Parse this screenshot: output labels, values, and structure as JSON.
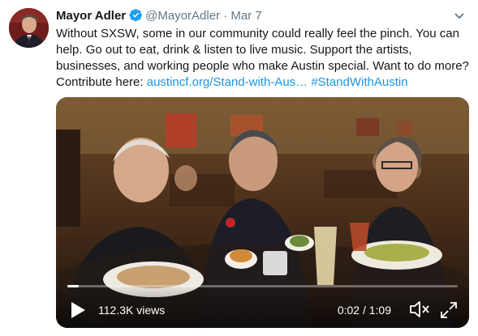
{
  "tweet": {
    "author_name": "Mayor Adler",
    "handle": "@MayorAdler",
    "separator": "·",
    "date": "Mar 7",
    "verified": true,
    "text_main": "Without SXSW, some in our community could really feel the pinch. You can help. Go out to eat, drink & listen to live music. Support the artists, businesses, and working people who make Austin special. Want to do more? Contribute here: ",
    "link_text": "austincf.org/Stand-with-Aus…",
    "hashtag": "#StandWithAustin"
  },
  "video": {
    "views": "112.3K views",
    "time": "0:02 / 1:09",
    "progress": 0.03
  },
  "icons": {
    "verified": "verified-badge-icon",
    "menu": "chevron-down-icon",
    "play": "play-icon",
    "volume": "volume-muted-icon",
    "fullscreen": "fullscreen-icon"
  },
  "colors": {
    "link": "#1b95e0",
    "verified": "#1da1f2",
    "text": "#14171a",
    "muted": "#657786"
  }
}
